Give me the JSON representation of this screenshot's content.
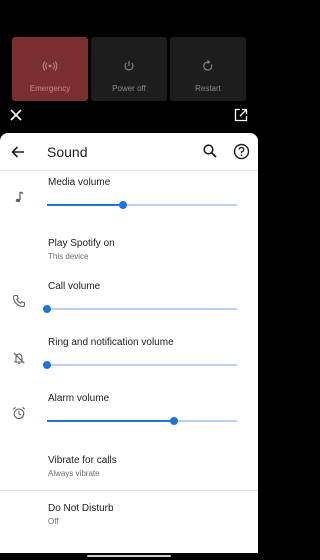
{
  "power_menu": {
    "emergency_label": "Emergency",
    "poweroff_label": "Power off",
    "restart_label": "Restart"
  },
  "settings": {
    "title": "Sound",
    "media_volume": {
      "label": "Media volume",
      "level": 0.4
    },
    "play_media": {
      "label": "Play Spotify on",
      "sub": "This device"
    },
    "call_volume": {
      "label": "Call volume",
      "level": 0.0
    },
    "ring_volume": {
      "label": "Ring and notification volume",
      "level": 0.0
    },
    "alarm_volume": {
      "label": "Alarm volume",
      "level": 0.67
    },
    "vibrate": {
      "label": "Vibrate for calls",
      "sub": "Always vibrate"
    },
    "dnd": {
      "label": "Do Not Disturb",
      "sub": "Off"
    }
  },
  "colors": {
    "accent": "#1a73e8",
    "emergency": "#7b2e2e"
  },
  "icons": [
    "emergency-icon",
    "power-icon",
    "restart-icon",
    "close-icon",
    "open-external-icon",
    "back-arrow-icon",
    "search-icon",
    "help-icon",
    "music-note-icon",
    "phone-icon",
    "bell-off-icon",
    "alarm-clock-icon"
  ]
}
